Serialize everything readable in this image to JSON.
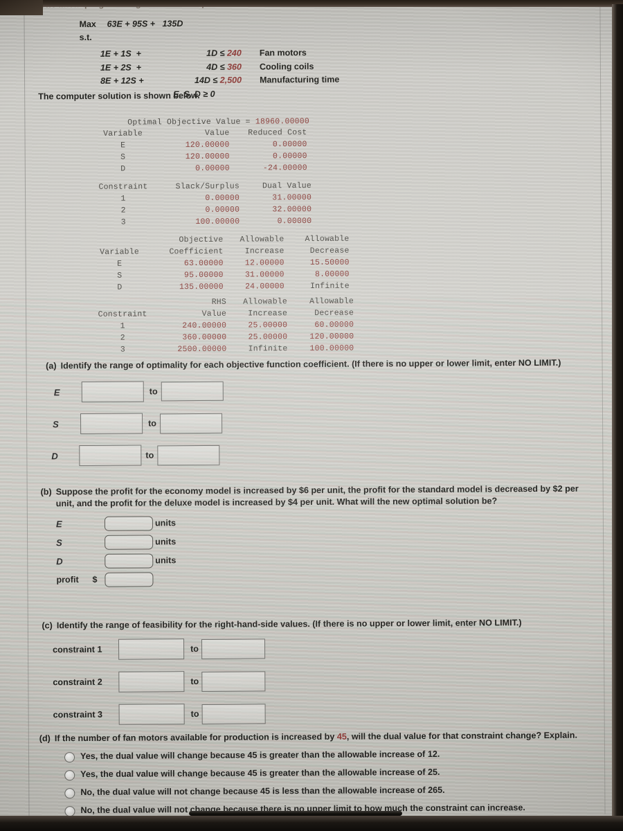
{
  "header": {
    "intro": "The linear programming model for the problem is as follows."
  },
  "model": {
    "max_label": "Max",
    "objective": "63E + 95S +   135D",
    "st_label": "s.t.",
    "constraints": [
      {
        "lhs": "1E + 1S  +",
        "rhs": "1D ≤ 240",
        "rhs_num": "240",
        "rhs_expr": "1D ≤",
        "name": "Fan motors"
      },
      {
        "lhs": "1E + 2S  +",
        "rhs": "4D ≤ 360",
        "rhs_num": "360",
        "rhs_expr": "4D ≤",
        "name": "Cooling coils"
      },
      {
        "lhs": "8E + 12S +",
        "rhs": "14D ≤ 2,500",
        "rhs_num": "2,500",
        "rhs_expr": "14D ≤",
        "name": "Manufacturing time"
      }
    ],
    "nonneg": "E, S, D ≥ 0"
  },
  "solution": {
    "intro": "The computer solution is shown below.",
    "objective_label": "Optimal Objective Value =",
    "objective_value": "18960.00000",
    "variable_table": {
      "headers": [
        "Variable",
        "Value",
        "Reduced Cost"
      ],
      "rows": [
        {
          "variable": "E",
          "value": "120.00000",
          "reduced_cost": "0.00000"
        },
        {
          "variable": "S",
          "value": "120.00000",
          "reduced_cost": "0.00000"
        },
        {
          "variable": "D",
          "value": "0.00000",
          "reduced_cost": "-24.00000"
        }
      ]
    },
    "constraint_table": {
      "headers": [
        "Constraint",
        "Slack/Surplus",
        "Dual Value"
      ],
      "rows": [
        {
          "constraint": "1",
          "slack": "0.00000",
          "dual": "31.00000"
        },
        {
          "constraint": "2",
          "slack": "0.00000",
          "dual": "32.00000"
        },
        {
          "constraint": "3",
          "slack": "100.00000",
          "dual": "0.00000"
        }
      ]
    },
    "objective_ranges": {
      "headers": [
        "Variable",
        "Objective",
        "Coefficient",
        "Allowable",
        "Increase",
        "Allowable",
        "Decrease"
      ],
      "h_var": "Variable",
      "h_obj1": "Objective",
      "h_obj2": "Coefficient",
      "h_inc1": "Allowable",
      "h_inc2": "Increase",
      "h_dec1": "Allowable",
      "h_dec2": "Decrease",
      "rows": [
        {
          "variable": "E",
          "coefficient": "63.00000",
          "increase": "12.00000",
          "decrease": "15.50000"
        },
        {
          "variable": "S",
          "coefficient": "95.00000",
          "increase": "31.00000",
          "decrease": "8.00000"
        },
        {
          "variable": "D",
          "coefficient": "135.00000",
          "increase": "24.00000",
          "decrease": "Infinite"
        }
      ]
    },
    "rhs_ranges": {
      "h_con": "Constraint",
      "h_rhs1": "RHS",
      "h_rhs2": "Value",
      "h_inc1": "Allowable",
      "h_inc2": "Increase",
      "h_dec1": "Allowable",
      "h_dec2": "Decrease",
      "rows": [
        {
          "constraint": "1",
          "rhs": "240.00000",
          "increase": "25.00000",
          "decrease": "60.00000"
        },
        {
          "constraint": "2",
          "rhs": "360.00000",
          "increase": "25.00000",
          "decrease": "120.00000"
        },
        {
          "constraint": "3",
          "rhs": "2500.00000",
          "increase": "Infinite",
          "decrease": "100.00000"
        }
      ]
    }
  },
  "question_a": {
    "marker": "(a)",
    "text": "Identify the range of optimality for each objective function coefficient. (If there is no upper or lower limit, enter NO LIMIT.)",
    "to_label": "to",
    "rows": [
      {
        "label": "E",
        "lower": "",
        "upper": ""
      },
      {
        "label": "S",
        "lower": "",
        "upper": ""
      },
      {
        "label": "D",
        "lower": "",
        "upper": ""
      }
    ]
  },
  "question_b": {
    "marker": "(b)",
    "text": "Suppose the profit for the economy model is increased by $6 per unit, the profit for the standard model is decreased by $2 per unit, and the profit for the deluxe model is increased by $4 per unit. What will the new optimal solution be?",
    "units_label": "units",
    "profit_label": "profit",
    "dollar_sign": "$",
    "rows": [
      {
        "label": "E",
        "value": ""
      },
      {
        "label": "S",
        "value": ""
      },
      {
        "label": "D",
        "value": ""
      }
    ],
    "profit_value": ""
  },
  "question_c": {
    "marker": "(c)",
    "text": "Identify the range of feasibility for the right-hand-side values. (If there is no upper or lower limit, enter NO LIMIT.)",
    "to_label": "to",
    "rows": [
      {
        "label": "constraint 1",
        "lower": "",
        "upper": ""
      },
      {
        "label": "constraint 2",
        "lower": "",
        "upper": ""
      },
      {
        "label": "constraint 3",
        "lower": "",
        "upper": ""
      }
    ]
  },
  "question_d": {
    "marker": "(d)",
    "text_part1": "If the number of fan motors available for production is increased by",
    "highlight": "45",
    "text_part2": ", will the dual value for that constraint change? Explain.",
    "options": [
      "Yes, the dual value will change because 45 is greater than the allowable increase of 12.",
      "Yes, the dual value will change because 45 is greater than the allowable increase of 25.",
      "No, the dual value will not change because 45 is less than the allowable increase of 265.",
      "No, the dual value will not change because there is no upper limit to how much the constraint can increase."
    ]
  },
  "colors": {
    "page_bg": "#cdccc7",
    "text": "#22221f",
    "mono_text": "#4c4b46",
    "value_red": "#8a3f3b",
    "field_border": "#6f6f6c"
  }
}
